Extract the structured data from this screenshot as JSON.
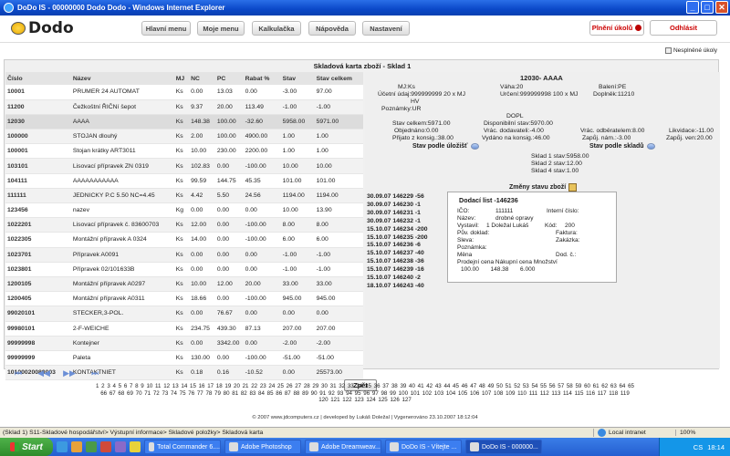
{
  "window": {
    "title": "DoDo IS - 00000000 Dodo Dodo - Windows Internet Explorer"
  },
  "header": {
    "logo": "Dodo",
    "menu": [
      "Hlavní menu",
      "Moje menu",
      "Kalkulačka",
      "Nápověda",
      "Nastavení"
    ],
    "tasks_label": "Plnění úkolů",
    "logout_label": "Odhlásit",
    "unfinished_link": "Nesplněné úkoly"
  },
  "card": {
    "title": "Skladová karta zboží - Sklad 1"
  },
  "table": {
    "headers": [
      "Číslo",
      "Název",
      "MJ",
      "NC",
      "PC",
      "Rabat %",
      "Stav",
      "Stav celkem"
    ],
    "rows": [
      [
        "10001",
        "PRUMER 24 AUTOMAT",
        "Ks",
        "0.00",
        "13.03",
        "0.00",
        "-3.00",
        "97.00"
      ],
      [
        "11200",
        "Čežkoštní ŘIČNí šepot",
        "Ks",
        "9.37",
        "20.00",
        "113.49",
        "-1.00",
        "-1.00"
      ],
      [
        "12030",
        "AAAA",
        "Ks",
        "148.38",
        "100.00",
        "-32.60",
        "5958.00",
        "5971.00"
      ],
      [
        "100000",
        "STOJAN dlouhý",
        "Ks",
        "2.00",
        "100.00",
        "4900.00",
        "1.00",
        "1.00"
      ],
      [
        "100001",
        "Stojan krátky ART3011",
        "Ks",
        "10.00",
        "230.00",
        "2200.00",
        "1.00",
        "1.00"
      ],
      [
        "103101",
        "Lisovací přípravek ZN 0319",
        "Ks",
        "102.83",
        "0.00",
        "-100.00",
        "10.00",
        "10.00"
      ],
      [
        "104111",
        "AAAAAAAAAAA",
        "Ks",
        "99.59",
        "144.75",
        "45.35",
        "101.00",
        "101.00"
      ],
      [
        "111111",
        "JEDNICKY P.C 5.50 NC=4.45",
        "Ks",
        "4.42",
        "5.50",
        "24.56",
        "1194.00",
        "1194.00"
      ],
      [
        "123456",
        "nazev",
        "Kg",
        "0.00",
        "0.00",
        "0.00",
        "10.00",
        "13.90"
      ],
      [
        "1022201",
        "Lisovací přípravek č. 83600703",
        "Ks",
        "12.00",
        "0.00",
        "-100.00",
        "8.00",
        "8.00"
      ],
      [
        "1022305",
        "Montážní přípravek A 0324",
        "Ks",
        "14.00",
        "0.00",
        "-100.00",
        "6.00",
        "6.00"
      ],
      [
        "1023701",
        "Přípravek A0091",
        "Ks",
        "0.00",
        "0.00",
        "0.00",
        "-1.00",
        "-1.00"
      ],
      [
        "1023801",
        "Přípravek 02/101633B",
        "Ks",
        "0.00",
        "0.00",
        "0.00",
        "-1.00",
        "-1.00"
      ],
      [
        "1200105",
        "Montážní přípravek A0297",
        "Ks",
        "10.00",
        "12.00",
        "20.00",
        "33.00",
        "33.00"
      ],
      [
        "1200405",
        "Montážní přípravek A0311",
        "Ks",
        "18.66",
        "0.00",
        "-100.00",
        "945.00",
        "945.00"
      ],
      [
        "99020101",
        "STECKER,3-POL.",
        "Ks",
        "0.00",
        "76.67",
        "0.00",
        "0.00",
        "0.00"
      ],
      [
        "99980101",
        "2-F-WEICHE",
        "Ks",
        "234.75",
        "439.30",
        "87.13",
        "207.00",
        "207.00"
      ],
      [
        "99999998",
        "Kontejner",
        "Ks",
        "0.00",
        "3342.00",
        "0.00",
        "-2.00",
        "-2.00"
      ],
      [
        "99999999",
        "Paleta",
        "Ks",
        "130.00",
        "0.00",
        "-100.00",
        "-51.00",
        "-51.00"
      ],
      [
        "10100020080003",
        "KONTAKTNIET",
        "Ks",
        "0.18",
        "0.16",
        "-10.52",
        "0.00",
        "25573.00"
      ]
    ],
    "selected_row": 2
  },
  "pager": {
    "buttons": [
      "⏮",
      "◀◀",
      "▶▶",
      "⏭"
    ]
  },
  "detail": {
    "title": "12030- AAAA",
    "mj": "MJ:Ks",
    "vaha": "Váha:20",
    "baleni": "Balení:PE",
    "ucetni": "Účetní údaj:999999999 20 x MJ",
    "urceni": "Určení:999999998 100 x MJ",
    "doplnek": "Doplněk:11210",
    "hv": "HV",
    "poznamky": "Poznámky:UR",
    "dopl": "DOPL",
    "stav_celkem": "Stav celkem:5971.00",
    "disponibilni": "Disponibilní stav:5970.00",
    "objednano": "Objednáno:0.00",
    "vrac_dod": "Vrác. dodavateli:-4.00",
    "vrac_odb": "Vrác. odběratelem:8.00",
    "likvidace": "Likvidace:-11.00",
    "zapuj_nam": "Zapůj. nám.:-3.00",
    "zapuj_ven": "Zapůj. ven:20.00",
    "prijato": "Přijato z konsig.:38.00",
    "vydano": "Vydáno na konsig.:46.00"
  },
  "stav_ulozist": {
    "label": "Stav podle úložišť"
  },
  "stav_sklady": {
    "label": "Stav podle skladů",
    "items": [
      "Sklad 1 stav:5958.00",
      "Sklad 2 stav:12.00",
      "Sklad 4 stav:1.00"
    ]
  },
  "zmeny": {
    "label": "Změny stavu zboží",
    "list": [
      "30.09.07 146229 -56",
      "30.09.07 146230 -1",
      "30.09.07 146231 -1",
      "30.09.07 146232 -1",
      "15.10.07 146234 -200",
      "15.10.07 146235 -200",
      "15.10.07 146236 -6",
      "15.10.07 146237 -40",
      "15.10.07 146238 -36",
      "15.10.07 146239 -16",
      "15.10.07 146240 -2",
      "18.10.07 146243 -40"
    ]
  },
  "dodaci": {
    "title": "Dodací list -146236",
    "ico": "IČO:",
    "ico_val": "111111",
    "interni": "Interní číslo:",
    "nazev": "Název:",
    "nazev_val": "drobné opravy",
    "vystavil": "Vystavil:",
    "vystavil_val": "1 Doležal Lukáš",
    "kod": "Kód:",
    "kod_val": "200",
    "puv": "Pův. doklad:",
    "faktura": "Faktura:",
    "sleva": "Sleva:",
    "zakazka": "Zakázka:",
    "poznamka": "Poznámka:",
    "mena": "Měna",
    "dod": "Dod. č.:",
    "cols": "Prodejní cena Nákupní cena Množství",
    "vals": "100.00       148.38       6.000"
  },
  "zpet_label": "Zpět",
  "pages": "1 2 3 4 5 6 7 8 9 10 11 12 13 14 15 16 17 18 19 20 21 22 23 24 25 26 27 28 29 30 31 32 33 34 35 36 37 38 39 40 41 42 43 44 45 46 47 48 49 50 51 52 53 54 55 56 57 58 59 60 61 62 63 64 65 66 67 68 69 70 71 72 73 74 75 76 77 78 79 80 81 82 83 84 85 86 87 88 89 90 91 92 93 94 95 96 97 98 99 100 101 102 103 104 105 106 107 108 109 110 111 112 113 114 115 116 117 118 119 120 121 122 123 124 125 126 127",
  "footer": "© 2007 www.jdcomputers.cz | developed by Lukáš Doležal | Vygenerováno 23.10.2007 18:12:04",
  "statusbar": {
    "path": "(Sklad 1) S11-Skladové hospodářství> Výstupní informace> Skladové položky> Skladová karta",
    "zone": "Local intranet",
    "zoom": "100%"
  },
  "taskbar": {
    "start": "Start",
    "items": [
      "Total Commander 6....",
      "Adobe Photoshop",
      "Adobe Dreamweav...",
      "DoDo IS - Vítejte ...",
      "DoDo IS - 000000..."
    ],
    "lang": "CS",
    "time": "18:14"
  }
}
